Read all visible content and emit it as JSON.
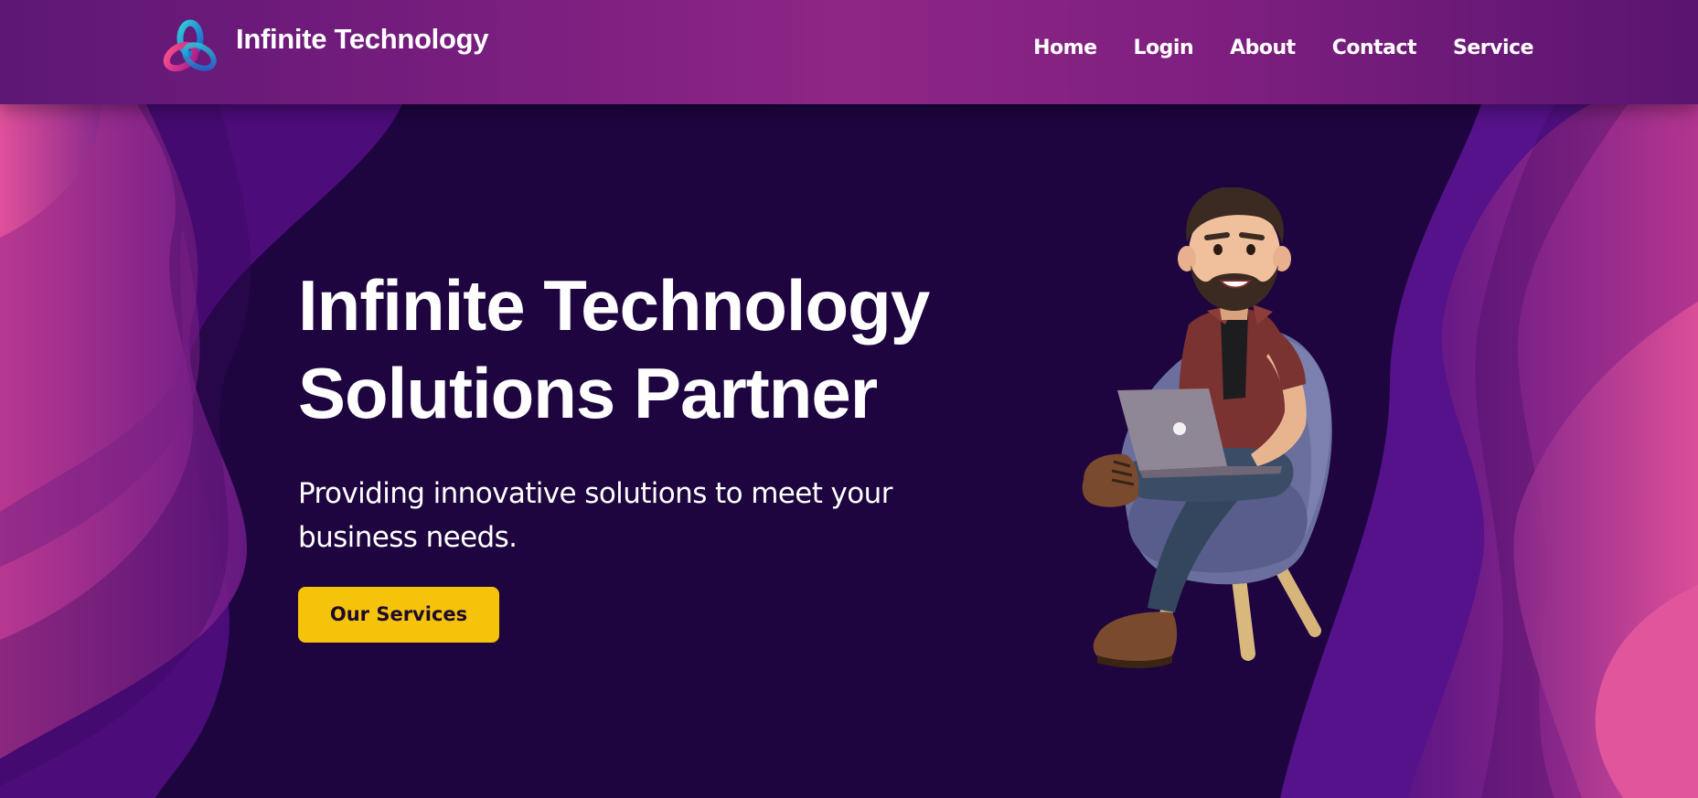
{
  "header": {
    "brand_name": "Infinite Technology",
    "logo_icon": "infinite-knot-logo-icon",
    "nav": [
      {
        "label": "Home"
      },
      {
        "label": "Login"
      },
      {
        "label": "About"
      },
      {
        "label": "Contact"
      },
      {
        "label": "Service"
      }
    ]
  },
  "hero": {
    "title_line1": "Infinite Technology",
    "title_line2": "Solutions Partner",
    "subtitle_line1": "Providing innovative solutions to meet your",
    "subtitle_line2": "business needs.",
    "cta_label": "Our Services",
    "illustration": "man-with-laptop-on-chair-illustration"
  },
  "colors": {
    "background": "#1e0540",
    "header_gradient_center": "#8e2685",
    "cta": "#f5c30a",
    "wave_pink": "#d9488f",
    "wave_purple": "#5a0f86"
  }
}
